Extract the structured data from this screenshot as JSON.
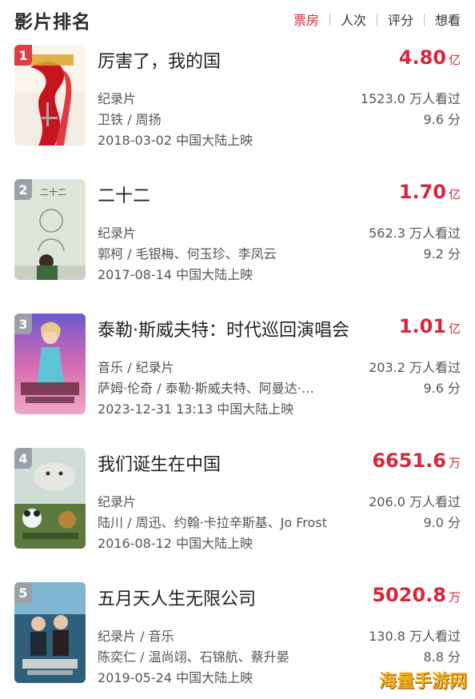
{
  "header": {
    "title": "影片排名",
    "tabs": [
      {
        "label": "票房",
        "active": true
      },
      {
        "label": "人次",
        "active": false
      },
      {
        "label": "评分",
        "active": false
      },
      {
        "label": "想看",
        "active": false
      }
    ]
  },
  "colors": {
    "accent": "#d6283c",
    "badge_top": "#e03a44",
    "badge_other": "#9aa0a6"
  },
  "movies": [
    {
      "rank": "1",
      "title": "厉害了，我的国",
      "box_value": "4.80",
      "box_unit": "亿",
      "genre": "纪录片",
      "cast": "卫铁 / 周扬",
      "release": "2018-03-02 中国大陆上映",
      "viewers": "1523.0 万人看过",
      "rating": "9.6 分",
      "poster_icon": "poster-red-ribbon-image"
    },
    {
      "rank": "2",
      "title": "二十二",
      "box_value": "1.70",
      "box_unit": "亿",
      "genre": "纪录片",
      "cast": "郭柯 / 毛银梅、何玉珍、李凤云",
      "release": "2017-08-14 中国大陆上映",
      "viewers": "562.3 万人看过",
      "rating": "9.2 分",
      "poster_icon": "poster-chalkboard-image",
      "poster_text": "二十二"
    },
    {
      "rank": "3",
      "title": "泰勒·斯威夫特：时代巡回演唱会",
      "box_value": "1.01",
      "box_unit": "亿",
      "genre": "音乐 / 纪录片",
      "cast": "萨姆·伦奇 / 泰勒·斯威夫特、阿曼达·…",
      "release": "2023-12-31 13:13 中国大陆上映",
      "viewers": "203.2 万人看过",
      "rating": "9.6 分",
      "poster_icon": "poster-concert-image"
    },
    {
      "rank": "4",
      "title": "我们诞生在中国",
      "box_value": "6651.6",
      "box_unit": "万",
      "genre": "纪录片",
      "cast": "陆川 / 周迅、约翰·卡拉辛斯基、Jo Frost",
      "release": "2016-08-12 中国大陆上映",
      "viewers": "206.0 万人看过",
      "rating": "9.0 分",
      "poster_icon": "poster-animals-image"
    },
    {
      "rank": "5",
      "title": "五月天人生无限公司",
      "box_value": "5020.8",
      "box_unit": "万",
      "genre": "纪录片 / 音乐",
      "cast": "陈奕仁 / 温尚翊、石锦航、蔡升晏",
      "release": "2019-05-24 中国大陆上映",
      "viewers": "130.8 万人看过",
      "rating": "8.8 分",
      "poster_icon": "poster-band-image"
    }
  ],
  "watermark": "海量手游网"
}
